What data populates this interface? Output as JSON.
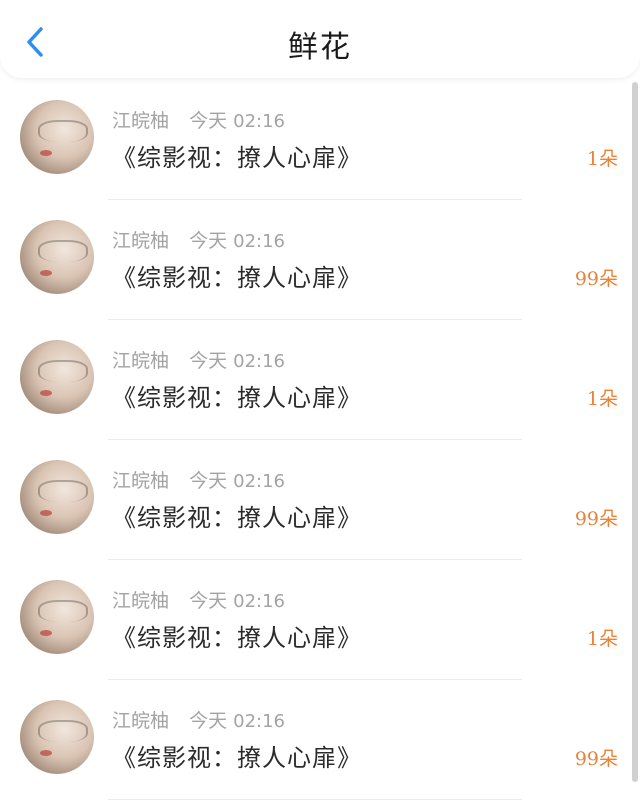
{
  "header": {
    "title": "鲜花",
    "back_icon": "chevron-left-icon",
    "back_color": "#2c8ff0"
  },
  "records": [
    {
      "user": "江皖柚",
      "date": "今天",
      "time": "02:16",
      "book": "《综影视：撩人心扉》",
      "count": "1朵"
    },
    {
      "user": "江皖柚",
      "date": "今天",
      "time": "02:16",
      "book": "《综影视：撩人心扉》",
      "count": "99朵"
    },
    {
      "user": "江皖柚",
      "date": "今天",
      "time": "02:16",
      "book": "《综影视：撩人心扉》",
      "count": "1朵"
    },
    {
      "user": "江皖柚",
      "date": "今天",
      "time": "02:16",
      "book": "《综影视：撩人心扉》",
      "count": "99朵"
    },
    {
      "user": "江皖柚",
      "date": "今天",
      "time": "02:16",
      "book": "《综影视：撩人心扉》",
      "count": "1朵"
    },
    {
      "user": "江皖柚",
      "date": "今天",
      "time": "02:16",
      "book": "《综影视：撩人心扉》",
      "count": "99朵"
    }
  ],
  "colors": {
    "accent_count": "#e8823a",
    "meta_text": "#a3a3a3"
  }
}
